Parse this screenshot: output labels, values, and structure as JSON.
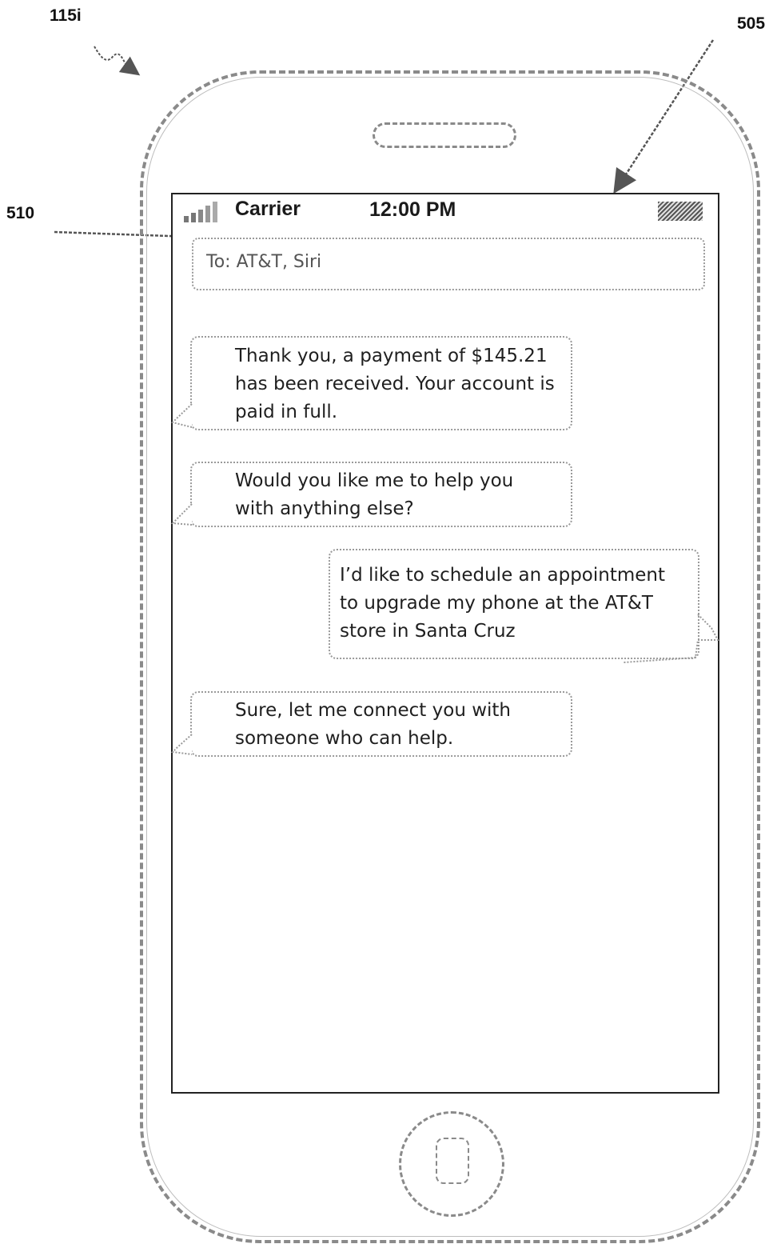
{
  "refs": {
    "device": "115i",
    "screen": "505",
    "to_field": "510"
  },
  "status_bar": {
    "carrier": "Carrier",
    "time": "12:00 PM"
  },
  "compose": {
    "to": "To: AT&T, Siri"
  },
  "messages": [
    {
      "sender": "agent",
      "text": "Thank you, a payment of $145.21 has been received. Your account is paid in full.",
      "lines": [
        "Thank you, a payment of $145.21",
        "has been received. Your account is",
        "paid in full."
      ]
    },
    {
      "sender": "agent",
      "text": "Would you like me to help you with anything else?",
      "lines": [
        "Would you like me to help you",
        "with anything else?"
      ]
    },
    {
      "sender": "user",
      "text": "I’d like to schedule an appointment to upgrade my phone at the AT&T store in Santa Cruz",
      "lines": [
        "I’d like to schedule an appointment",
        "to upgrade my phone at the AT&T",
        "store in Santa Cruz"
      ]
    },
    {
      "sender": "agent",
      "text": "Sure, let me connect you with someone who can help.",
      "lines": [
        "Sure, let me connect you with",
        "someone who can help."
      ]
    }
  ]
}
